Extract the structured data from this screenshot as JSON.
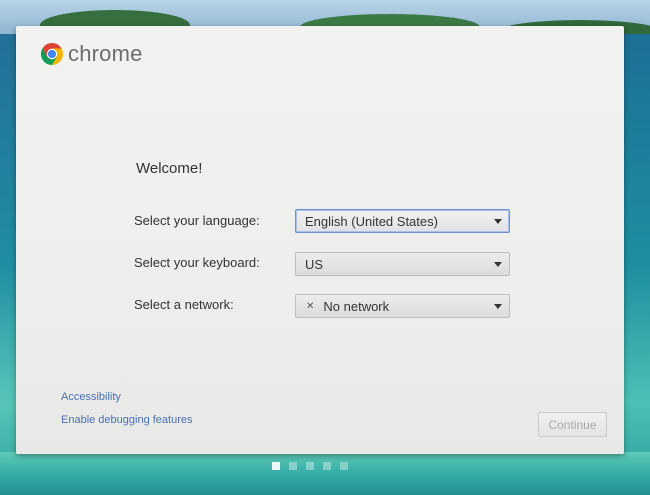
{
  "brand": {
    "name": "chrome",
    "logo_icon": "chrome-logo-icon"
  },
  "welcome": "Welcome!",
  "form": {
    "language_label": "Select your language:",
    "language_value": "English (United States)",
    "keyboard_label": "Select your keyboard:",
    "keyboard_value": "US",
    "network_label": "Select a network:",
    "network_value": "No network",
    "network_status_icon": "no-network-icon"
  },
  "links": {
    "accessibility": "Accessibility",
    "debugging": "Enable debugging features"
  },
  "continue_label": "Continue",
  "pager": {
    "count": 5,
    "active_index": 0
  },
  "colors": {
    "link": "#4a6fb5",
    "focus_border": "#6e93d0",
    "chrome_red": "#db4437",
    "chrome_green": "#0f9d58",
    "chrome_yellow": "#f4b400",
    "chrome_blue": "#4285f4"
  }
}
